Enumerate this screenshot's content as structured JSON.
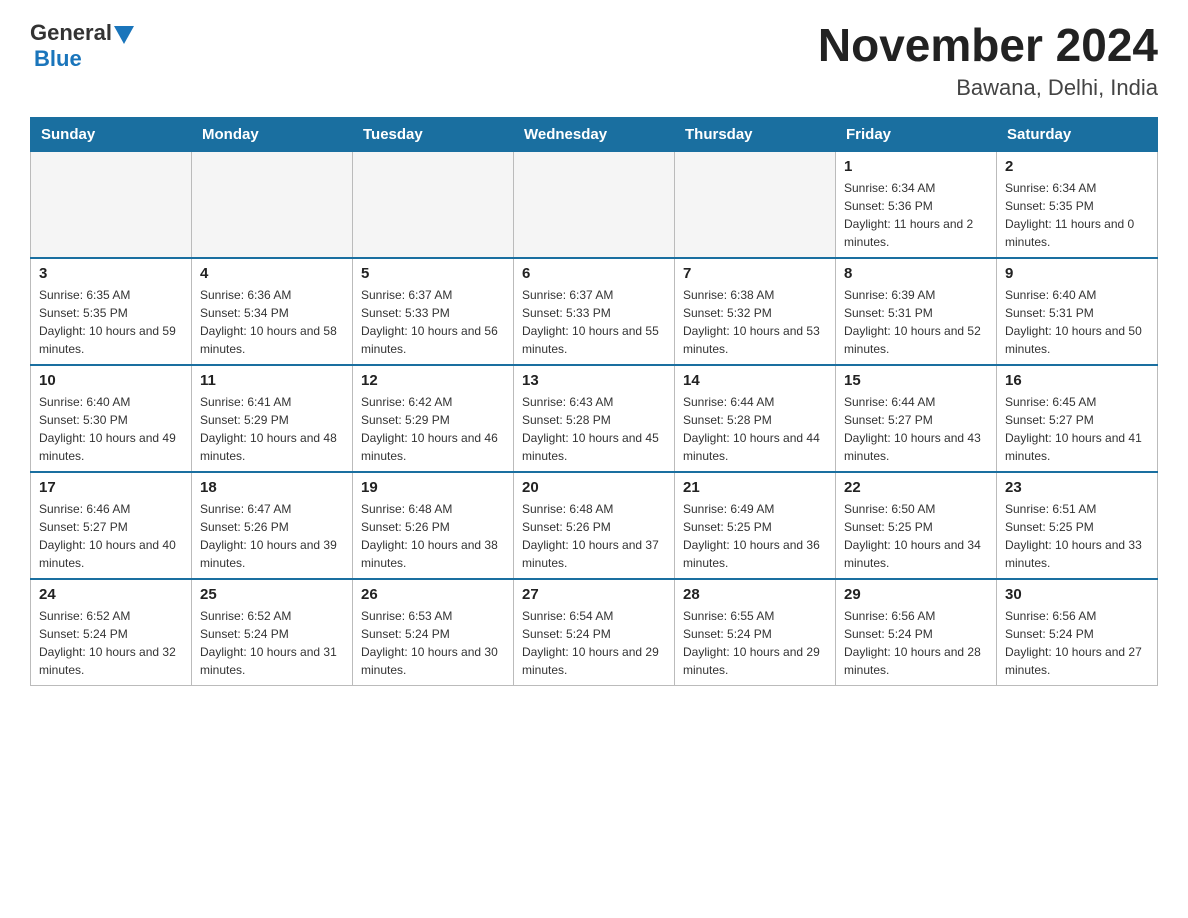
{
  "header": {
    "logo_general": "General",
    "logo_blue": "Blue",
    "title": "November 2024",
    "subtitle": "Bawana, Delhi, India"
  },
  "weekdays": [
    "Sunday",
    "Monday",
    "Tuesday",
    "Wednesday",
    "Thursday",
    "Friday",
    "Saturday"
  ],
  "weeks": [
    [
      {
        "day": "",
        "info": ""
      },
      {
        "day": "",
        "info": ""
      },
      {
        "day": "",
        "info": ""
      },
      {
        "day": "",
        "info": ""
      },
      {
        "day": "",
        "info": ""
      },
      {
        "day": "1",
        "info": "Sunrise: 6:34 AM\nSunset: 5:36 PM\nDaylight: 11 hours and 2 minutes."
      },
      {
        "day": "2",
        "info": "Sunrise: 6:34 AM\nSunset: 5:35 PM\nDaylight: 11 hours and 0 minutes."
      }
    ],
    [
      {
        "day": "3",
        "info": "Sunrise: 6:35 AM\nSunset: 5:35 PM\nDaylight: 10 hours and 59 minutes."
      },
      {
        "day": "4",
        "info": "Sunrise: 6:36 AM\nSunset: 5:34 PM\nDaylight: 10 hours and 58 minutes."
      },
      {
        "day": "5",
        "info": "Sunrise: 6:37 AM\nSunset: 5:33 PM\nDaylight: 10 hours and 56 minutes."
      },
      {
        "day": "6",
        "info": "Sunrise: 6:37 AM\nSunset: 5:33 PM\nDaylight: 10 hours and 55 minutes."
      },
      {
        "day": "7",
        "info": "Sunrise: 6:38 AM\nSunset: 5:32 PM\nDaylight: 10 hours and 53 minutes."
      },
      {
        "day": "8",
        "info": "Sunrise: 6:39 AM\nSunset: 5:31 PM\nDaylight: 10 hours and 52 minutes."
      },
      {
        "day": "9",
        "info": "Sunrise: 6:40 AM\nSunset: 5:31 PM\nDaylight: 10 hours and 50 minutes."
      }
    ],
    [
      {
        "day": "10",
        "info": "Sunrise: 6:40 AM\nSunset: 5:30 PM\nDaylight: 10 hours and 49 minutes."
      },
      {
        "day": "11",
        "info": "Sunrise: 6:41 AM\nSunset: 5:29 PM\nDaylight: 10 hours and 48 minutes."
      },
      {
        "day": "12",
        "info": "Sunrise: 6:42 AM\nSunset: 5:29 PM\nDaylight: 10 hours and 46 minutes."
      },
      {
        "day": "13",
        "info": "Sunrise: 6:43 AM\nSunset: 5:28 PM\nDaylight: 10 hours and 45 minutes."
      },
      {
        "day": "14",
        "info": "Sunrise: 6:44 AM\nSunset: 5:28 PM\nDaylight: 10 hours and 44 minutes."
      },
      {
        "day": "15",
        "info": "Sunrise: 6:44 AM\nSunset: 5:27 PM\nDaylight: 10 hours and 43 minutes."
      },
      {
        "day": "16",
        "info": "Sunrise: 6:45 AM\nSunset: 5:27 PM\nDaylight: 10 hours and 41 minutes."
      }
    ],
    [
      {
        "day": "17",
        "info": "Sunrise: 6:46 AM\nSunset: 5:27 PM\nDaylight: 10 hours and 40 minutes."
      },
      {
        "day": "18",
        "info": "Sunrise: 6:47 AM\nSunset: 5:26 PM\nDaylight: 10 hours and 39 minutes."
      },
      {
        "day": "19",
        "info": "Sunrise: 6:48 AM\nSunset: 5:26 PM\nDaylight: 10 hours and 38 minutes."
      },
      {
        "day": "20",
        "info": "Sunrise: 6:48 AM\nSunset: 5:26 PM\nDaylight: 10 hours and 37 minutes."
      },
      {
        "day": "21",
        "info": "Sunrise: 6:49 AM\nSunset: 5:25 PM\nDaylight: 10 hours and 36 minutes."
      },
      {
        "day": "22",
        "info": "Sunrise: 6:50 AM\nSunset: 5:25 PM\nDaylight: 10 hours and 34 minutes."
      },
      {
        "day": "23",
        "info": "Sunrise: 6:51 AM\nSunset: 5:25 PM\nDaylight: 10 hours and 33 minutes."
      }
    ],
    [
      {
        "day": "24",
        "info": "Sunrise: 6:52 AM\nSunset: 5:24 PM\nDaylight: 10 hours and 32 minutes."
      },
      {
        "day": "25",
        "info": "Sunrise: 6:52 AM\nSunset: 5:24 PM\nDaylight: 10 hours and 31 minutes."
      },
      {
        "day": "26",
        "info": "Sunrise: 6:53 AM\nSunset: 5:24 PM\nDaylight: 10 hours and 30 minutes."
      },
      {
        "day": "27",
        "info": "Sunrise: 6:54 AM\nSunset: 5:24 PM\nDaylight: 10 hours and 29 minutes."
      },
      {
        "day": "28",
        "info": "Sunrise: 6:55 AM\nSunset: 5:24 PM\nDaylight: 10 hours and 29 minutes."
      },
      {
        "day": "29",
        "info": "Sunrise: 6:56 AM\nSunset: 5:24 PM\nDaylight: 10 hours and 28 minutes."
      },
      {
        "day": "30",
        "info": "Sunrise: 6:56 AM\nSunset: 5:24 PM\nDaylight: 10 hours and 27 minutes."
      }
    ]
  ]
}
